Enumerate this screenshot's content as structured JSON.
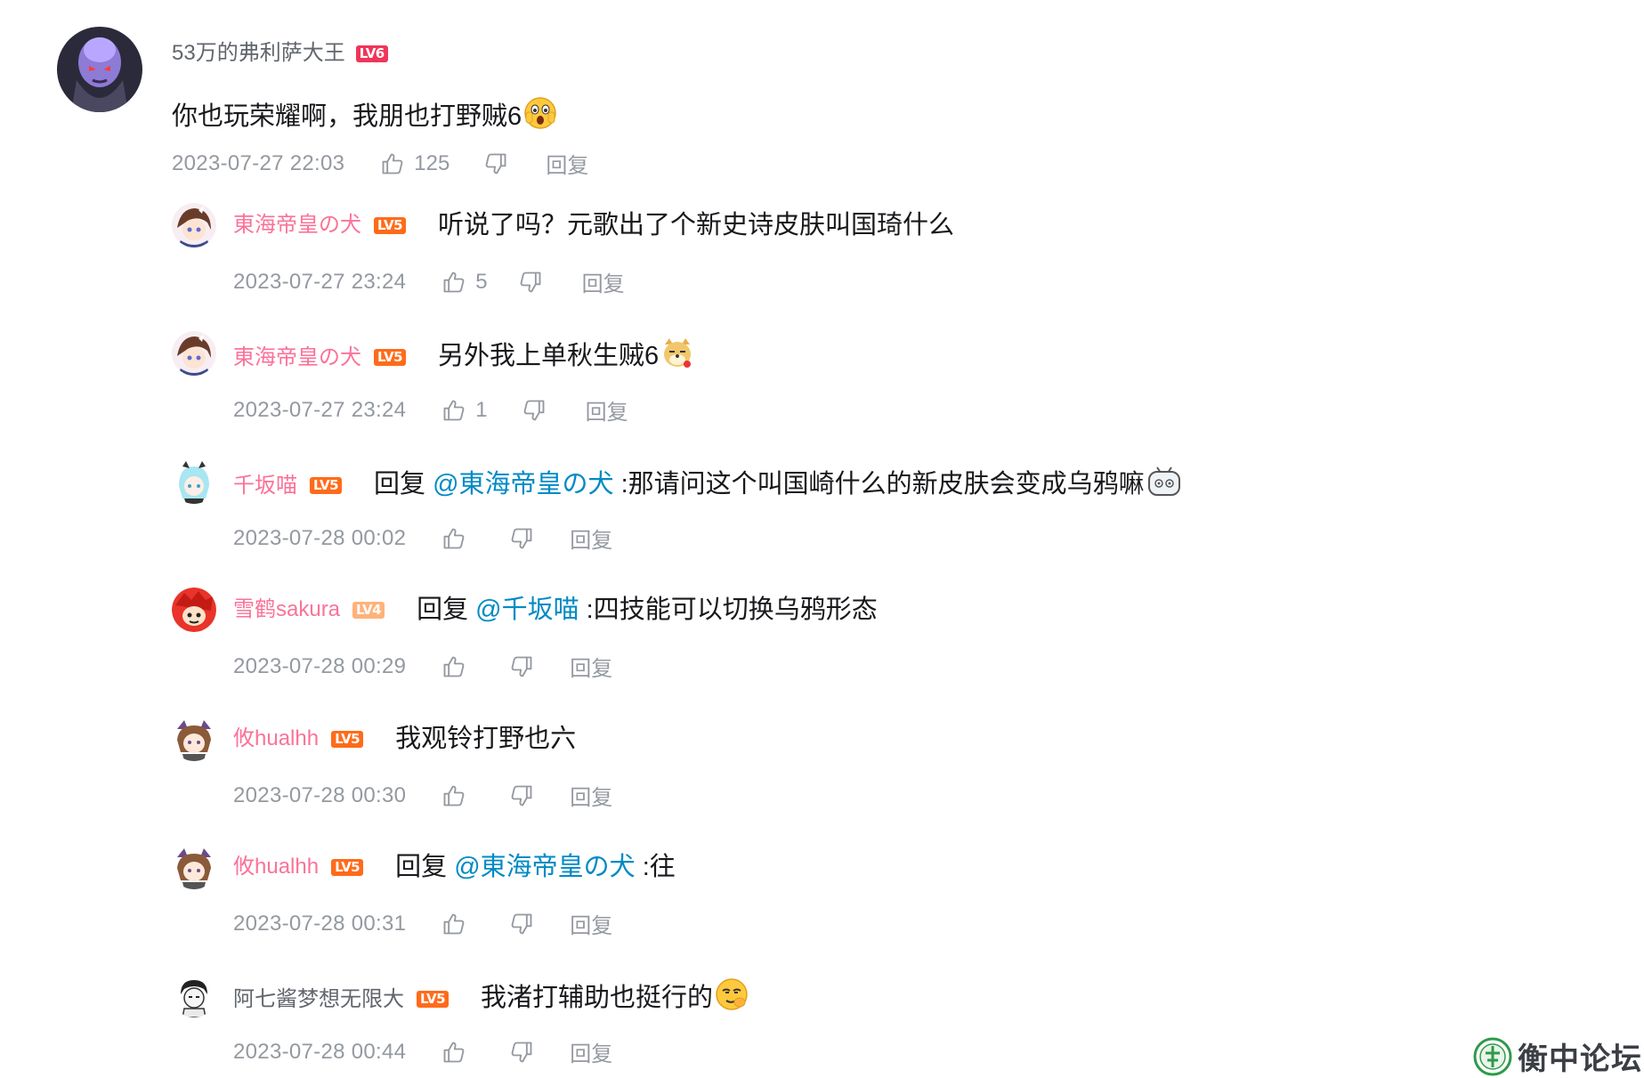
{
  "main_comment": {
    "username": "53万的弗利萨大王",
    "level": "LV6",
    "text": "你也玩荣耀啊，我朋也打野贼6",
    "time": "2023-07-27 22:03",
    "likes": "125",
    "reply_label": "回复"
  },
  "replies": [
    {
      "username": "東海帝皇の犬",
      "level": "LV5",
      "prefix": "",
      "mention": "",
      "text": "听说了吗？元歌出了个新史诗皮肤叫国琦什么",
      "time": "2023-07-27 23:24",
      "likes": "5",
      "reply_label": "回复"
    },
    {
      "username": "東海帝皇の犬",
      "level": "LV5",
      "prefix": "",
      "mention": "",
      "text": "另外我上单秋生贼6",
      "time": "2023-07-27 23:24",
      "likes": "1",
      "reply_label": "回复"
    },
    {
      "username": "千坂喵",
      "level": "LV5",
      "prefix": "回复 ",
      "mention": "@東海帝皇の犬",
      "text": " :那请问这个叫国崎什么的新皮肤会变成乌鸦嘛",
      "time": "2023-07-28 00:02",
      "likes": "",
      "reply_label": "回复"
    },
    {
      "username": "雪鹤sakura",
      "level": "LV4",
      "prefix": "回复 ",
      "mention": "@千坂喵",
      "text": " :四技能可以切换乌鸦形态",
      "time": "2023-07-28 00:29",
      "likes": "",
      "reply_label": "回复"
    },
    {
      "username": "攸hualhh",
      "level": "LV5",
      "prefix": "",
      "mention": "",
      "text": "我观铃打野也六",
      "time": "2023-07-28 00:30",
      "likes": "",
      "reply_label": "回复"
    },
    {
      "username": "攸hualhh",
      "level": "LV5",
      "prefix": "回复 ",
      "mention": "@東海帝皇の犬",
      "text": " :往",
      "time": "2023-07-28 00:31",
      "likes": "",
      "reply_label": "回复"
    },
    {
      "username": "阿七酱梦想无限大",
      "level": "LV5",
      "prefix": "",
      "mention": "",
      "text": "我渚打辅助也挺行的",
      "time": "2023-07-28 00:44",
      "likes": "",
      "reply_label": "回复"
    }
  ],
  "watermark": {
    "text": "衡中论坛"
  },
  "colors": {
    "username_pink": "#fb7299",
    "mention_blue": "#008ac5",
    "meta_grey": "#9499a0",
    "level_red": "#f0355a",
    "level_orange": "#ff6b1a"
  }
}
